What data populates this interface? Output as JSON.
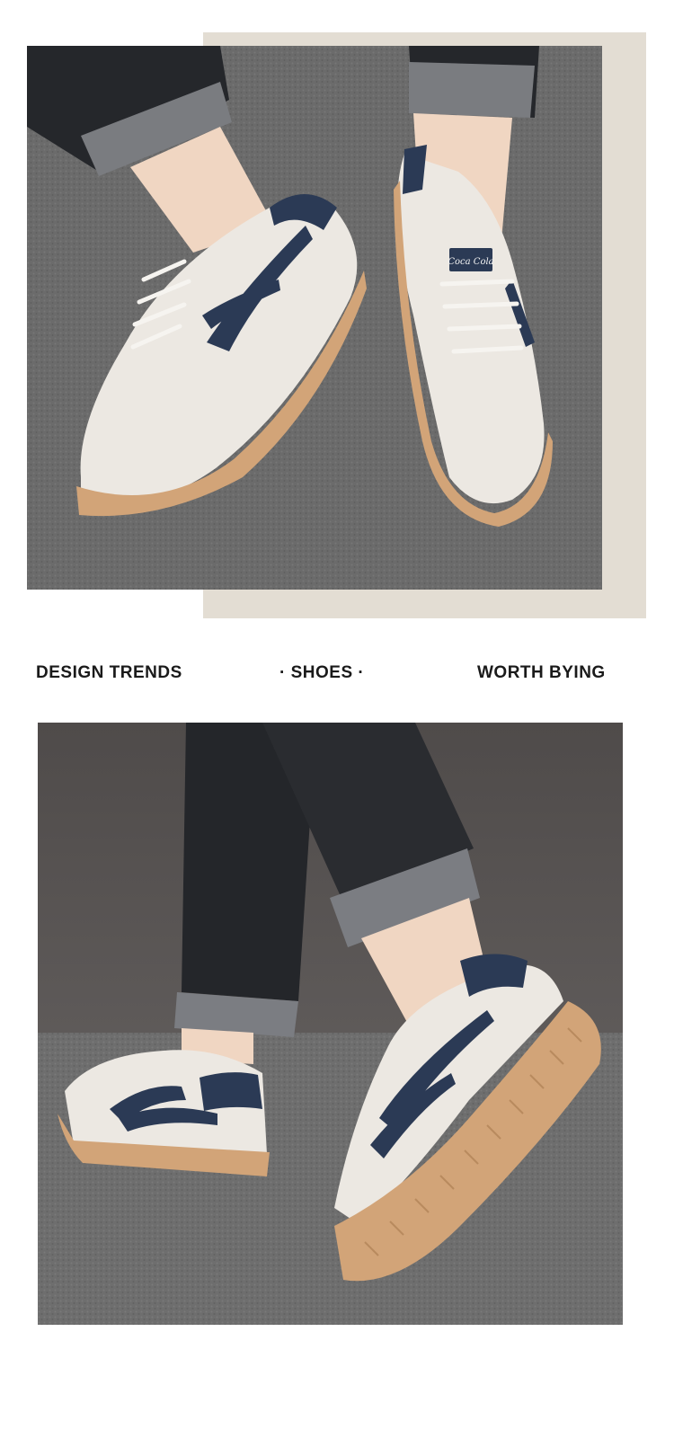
{
  "taglines": {
    "left": "DESIGN TRENDS",
    "center": "· SHOES ·",
    "right": "WORTH BYING"
  },
  "shoe_logo_text": "Coca Cola",
  "colors": {
    "frame": "#e3ddd3",
    "carpet": "#6a6a6a",
    "wall": "#5a5655",
    "denim": "#2a2c30",
    "cuff": "#7b7d82",
    "shoe_upper": "#ece8e2",
    "shoe_accent": "#2b3a55",
    "gum_sole": "#d2a478"
  }
}
